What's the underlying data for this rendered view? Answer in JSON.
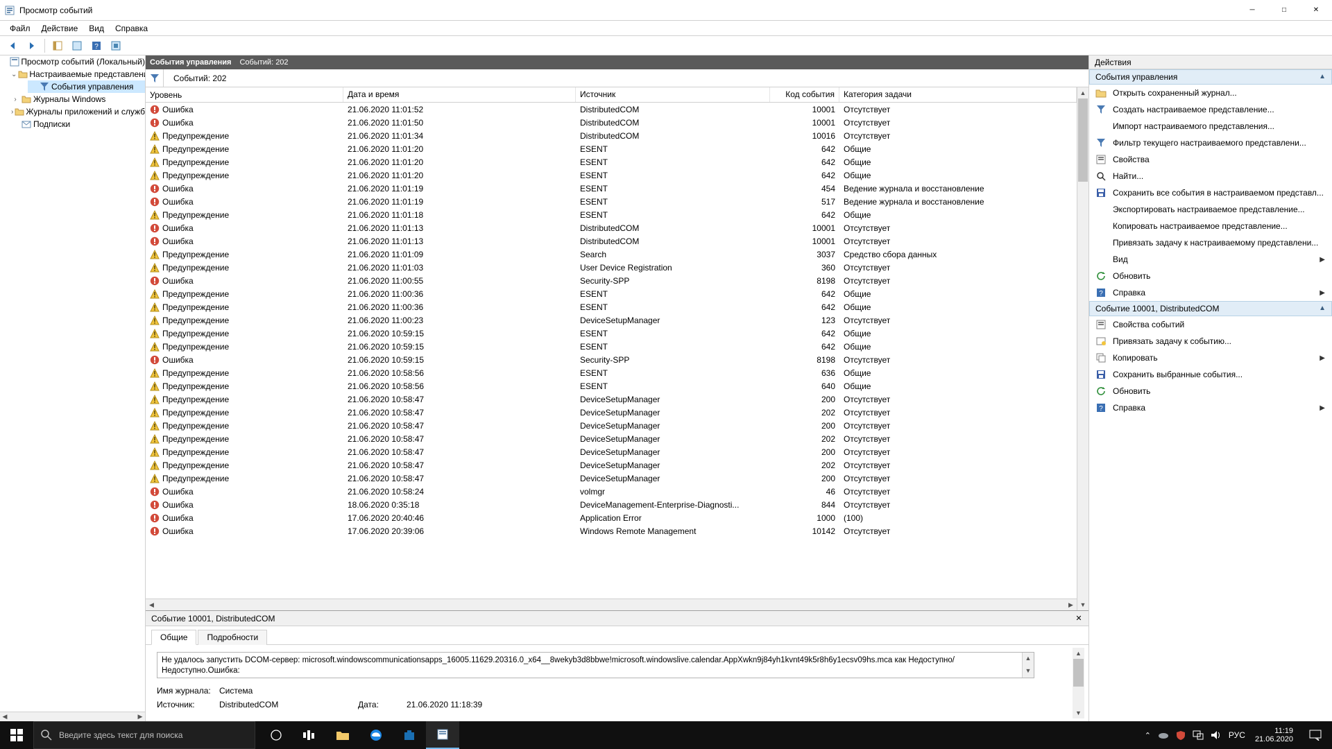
{
  "window": {
    "title": "Просмотр событий"
  },
  "menu": [
    "Файл",
    "Действие",
    "Вид",
    "Справка"
  ],
  "tree": {
    "root": "Просмотр событий (Локальный)",
    "nodes": [
      {
        "label": "Настраиваемые представления",
        "expanded": true,
        "children": [
          {
            "label": "События управления",
            "selected": true
          }
        ]
      },
      {
        "label": "Журналы Windows",
        "expanded": false
      },
      {
        "label": "Журналы приложений и служб",
        "expanded": false
      },
      {
        "label": "Подписки",
        "expanded": false
      }
    ]
  },
  "center": {
    "header_title": "События управления",
    "header_count": "Событий: 202",
    "filter_count": "Событий: 202"
  },
  "columns": {
    "level": "Уровень",
    "datetime": "Дата и время",
    "source": "Источник",
    "eventid": "Код события",
    "category": "Категория задачи"
  },
  "level_labels": {
    "error": "Ошибка",
    "warning": "Предупреждение"
  },
  "events": [
    {
      "lvl": "error",
      "dt": "21.06.2020 11:01:52",
      "src": "DistributedCOM",
      "id": 10001,
      "cat": "Отсутствует"
    },
    {
      "lvl": "error",
      "dt": "21.06.2020 11:01:50",
      "src": "DistributedCOM",
      "id": 10001,
      "cat": "Отсутствует"
    },
    {
      "lvl": "warning",
      "dt": "21.06.2020 11:01:34",
      "src": "DistributedCOM",
      "id": 10016,
      "cat": "Отсутствует"
    },
    {
      "lvl": "warning",
      "dt": "21.06.2020 11:01:20",
      "src": "ESENT",
      "id": 642,
      "cat": "Общие"
    },
    {
      "lvl": "warning",
      "dt": "21.06.2020 11:01:20",
      "src": "ESENT",
      "id": 642,
      "cat": "Общие"
    },
    {
      "lvl": "warning",
      "dt": "21.06.2020 11:01:20",
      "src": "ESENT",
      "id": 642,
      "cat": "Общие"
    },
    {
      "lvl": "error",
      "dt": "21.06.2020 11:01:19",
      "src": "ESENT",
      "id": 454,
      "cat": "Ведение журнала и восстановление"
    },
    {
      "lvl": "error",
      "dt": "21.06.2020 11:01:19",
      "src": "ESENT",
      "id": 517,
      "cat": "Ведение журнала и восстановление"
    },
    {
      "lvl": "warning",
      "dt": "21.06.2020 11:01:18",
      "src": "ESENT",
      "id": 642,
      "cat": "Общие"
    },
    {
      "lvl": "error",
      "dt": "21.06.2020 11:01:13",
      "src": "DistributedCOM",
      "id": 10001,
      "cat": "Отсутствует"
    },
    {
      "lvl": "error",
      "dt": "21.06.2020 11:01:13",
      "src": "DistributedCOM",
      "id": 10001,
      "cat": "Отсутствует"
    },
    {
      "lvl": "warning",
      "dt": "21.06.2020 11:01:09",
      "src": "Search",
      "id": 3037,
      "cat": "Средство сбора данных"
    },
    {
      "lvl": "warning",
      "dt": "21.06.2020 11:01:03",
      "src": "User Device Registration",
      "id": 360,
      "cat": "Отсутствует"
    },
    {
      "lvl": "error",
      "dt": "21.06.2020 11:00:55",
      "src": "Security-SPP",
      "id": 8198,
      "cat": "Отсутствует"
    },
    {
      "lvl": "warning",
      "dt": "21.06.2020 11:00:36",
      "src": "ESENT",
      "id": 642,
      "cat": "Общие"
    },
    {
      "lvl": "warning",
      "dt": "21.06.2020 11:00:36",
      "src": "ESENT",
      "id": 642,
      "cat": "Общие"
    },
    {
      "lvl": "warning",
      "dt": "21.06.2020 11:00:23",
      "src": "DeviceSetupManager",
      "id": 123,
      "cat": "Отсутствует"
    },
    {
      "lvl": "warning",
      "dt": "21.06.2020 10:59:15",
      "src": "ESENT",
      "id": 642,
      "cat": "Общие"
    },
    {
      "lvl": "warning",
      "dt": "21.06.2020 10:59:15",
      "src": "ESENT",
      "id": 642,
      "cat": "Общие"
    },
    {
      "lvl": "error",
      "dt": "21.06.2020 10:59:15",
      "src": "Security-SPP",
      "id": 8198,
      "cat": "Отсутствует"
    },
    {
      "lvl": "warning",
      "dt": "21.06.2020 10:58:56",
      "src": "ESENT",
      "id": 636,
      "cat": "Общие"
    },
    {
      "lvl": "warning",
      "dt": "21.06.2020 10:58:56",
      "src": "ESENT",
      "id": 640,
      "cat": "Общие"
    },
    {
      "lvl": "warning",
      "dt": "21.06.2020 10:58:47",
      "src": "DeviceSetupManager",
      "id": 200,
      "cat": "Отсутствует"
    },
    {
      "lvl": "warning",
      "dt": "21.06.2020 10:58:47",
      "src": "DeviceSetupManager",
      "id": 202,
      "cat": "Отсутствует"
    },
    {
      "lvl": "warning",
      "dt": "21.06.2020 10:58:47",
      "src": "DeviceSetupManager",
      "id": 200,
      "cat": "Отсутствует"
    },
    {
      "lvl": "warning",
      "dt": "21.06.2020 10:58:47",
      "src": "DeviceSetupManager",
      "id": 202,
      "cat": "Отсутствует"
    },
    {
      "lvl": "warning",
      "dt": "21.06.2020 10:58:47",
      "src": "DeviceSetupManager",
      "id": 200,
      "cat": "Отсутствует"
    },
    {
      "lvl": "warning",
      "dt": "21.06.2020 10:58:47",
      "src": "DeviceSetupManager",
      "id": 202,
      "cat": "Отсутствует"
    },
    {
      "lvl": "warning",
      "dt": "21.06.2020 10:58:47",
      "src": "DeviceSetupManager",
      "id": 200,
      "cat": "Отсутствует"
    },
    {
      "lvl": "error",
      "dt": "21.06.2020 10:58:24",
      "src": "volmgr",
      "id": 46,
      "cat": "Отсутствует"
    },
    {
      "lvl": "error",
      "dt": "18.06.2020 0:35:18",
      "src": "DeviceManagement-Enterprise-Diagnosti...",
      "id": 844,
      "cat": "Отсутствует"
    },
    {
      "lvl": "error",
      "dt": "17.06.2020 20:40:46",
      "src": "Application Error",
      "id": 1000,
      "cat": "(100)"
    },
    {
      "lvl": "error",
      "dt": "17.06.2020 20:39:06",
      "src": "Windows Remote Management",
      "id": 10142,
      "cat": "Отсутствует"
    }
  ],
  "detail": {
    "title": "Событие 10001, DistributedCOM",
    "tabs": {
      "general": "Общие",
      "details": "Подробности"
    },
    "description": "Не удалось запустить DCOM-сервер: microsoft.windowscommunicationsapps_16005.11629.20316.0_x64__8wekyb3d8bbwe!microsoft.windowslive.calendar.AppXwkn9j84yh1kvnt49k5r8h6y1ecsv09hs.mca как Недоступно/Недоступно.Ошибка:",
    "log_label": "Имя журнала:",
    "log_value": "Система",
    "src_label": "Источник:",
    "src_value": "DistributedCOM",
    "date_label": "Дата:",
    "date_value": "21.06.2020 11:18:39"
  },
  "actions": {
    "header": "Действия",
    "group1_title": "События управления",
    "group1": [
      {
        "icon": "open",
        "label": "Открыть сохраненный журнал..."
      },
      {
        "icon": "filter",
        "label": "Создать настраиваемое представление..."
      },
      {
        "icon": "blank",
        "label": "Импорт настраиваемого представления..."
      },
      {
        "icon": "filter",
        "label": "Фильтр текущего настраиваемого представлени..."
      },
      {
        "icon": "props",
        "label": "Свойства"
      },
      {
        "icon": "find",
        "label": "Найти..."
      },
      {
        "icon": "save",
        "label": "Сохранить все события в настраиваемом представл..."
      },
      {
        "icon": "blank",
        "label": "Экспортировать настраиваемое представление..."
      },
      {
        "icon": "blank",
        "label": "Копировать настраиваемое представление..."
      },
      {
        "icon": "blank",
        "label": "Привязать задачу к настраиваемому представлени..."
      },
      {
        "icon": "blank",
        "label": "Вид",
        "submenu": true
      },
      {
        "icon": "refresh",
        "label": "Обновить"
      },
      {
        "icon": "help",
        "label": "Справка",
        "submenu": true
      }
    ],
    "group2_title": "Событие 10001, DistributedCOM",
    "group2": [
      {
        "icon": "props",
        "label": "Свойства событий"
      },
      {
        "icon": "task",
        "label": "Привязать задачу к событию..."
      },
      {
        "icon": "copy",
        "label": "Копировать",
        "submenu": true
      },
      {
        "icon": "save",
        "label": "Сохранить выбранные события..."
      },
      {
        "icon": "refresh",
        "label": "Обновить"
      },
      {
        "icon": "help",
        "label": "Справка",
        "submenu": true
      }
    ]
  },
  "taskbar": {
    "search_placeholder": "Введите здесь текст для поиска",
    "lang": "РУС",
    "time": "11:19",
    "date": "21.06.2020"
  }
}
